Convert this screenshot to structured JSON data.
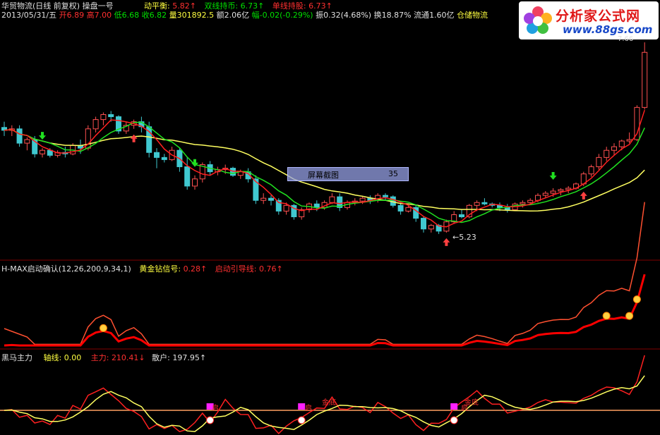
{
  "header": {
    "stock": "华贸物流(日线 前复权)",
    "indicator": "操盘一号",
    "dongpingheng_label": "动平衡:",
    "dongpingheng_value": "5.82↑",
    "shuangxian_label": "双线持币:",
    "shuangxian_value": "6.73↑",
    "danxian_label": "单线持股:",
    "danxian_value": "6.73↑"
  },
  "quote": {
    "date": "2013/05/31/五",
    "open_label": "开",
    "open": "6.89",
    "high_label": "高",
    "high": "7.00",
    "low_label": "低",
    "low": "6.68",
    "close_label": "收",
    "close": "6.82",
    "volume_label": "量",
    "volume": "301892.5",
    "amount_label": "额",
    "amount": "2.06亿",
    "change_label": "幅",
    "change": "-0.02(-0.29%)",
    "amplitude_label": "振",
    "amplitude": "0.32(4.68%)",
    "turnover_label": "换",
    "turnover": "18.87%",
    "float_label": "流通",
    "float": "1.60亿",
    "concept": "仓储物流"
  },
  "logo": {
    "title": "分析家公式网",
    "url": "www.88gs.com"
  },
  "annotations": {
    "low_price": "←5.23",
    "high_price": "7.66",
    "screenshot_tool": "屏幕截图",
    "screenshot_value": "35"
  },
  "panel2": {
    "title": "H-MAX启动确认(12,26,200,9,34,1)",
    "gold_label": "黄金钻信号:",
    "gold_value": "0.28↑",
    "start_label": "启动引导线:",
    "start_value": "0.76↑"
  },
  "panel3": {
    "title": "黑马主力",
    "axis_label": "轴线:",
    "axis_value": "0.00",
    "main_label": "主力:",
    "main_value": "210.41↓",
    "retail_label": "散户:",
    "retail_value": "197.95↑",
    "marker_jindi": "金底",
    "marker_qi": "启"
  },
  "chart_data": {
    "type": "candlestick",
    "colors": {
      "up": "#ff5050",
      "down": "#40c8d0",
      "ma_fast": "#ff2020",
      "ma_mid": "#20e020",
      "ma_slow": "#ffff60"
    },
    "ohlc": [
      [
        6.47,
        6.55,
        6.35,
        6.43
      ],
      [
        6.43,
        6.5,
        6.35,
        6.45
      ],
      [
        6.45,
        6.5,
        6.2,
        6.25
      ],
      [
        6.25,
        6.33,
        6.15,
        6.3
      ],
      [
        6.3,
        6.35,
        6.05,
        6.1
      ],
      [
        6.1,
        6.18,
        6.05,
        6.15
      ],
      [
        6.15,
        6.18,
        6.05,
        6.08
      ],
      [
        6.08,
        6.15,
        6.05,
        6.12
      ],
      [
        6.12,
        6.2,
        6.05,
        6.1
      ],
      [
        6.1,
        6.25,
        6.08,
        6.22
      ],
      [
        6.22,
        6.3,
        6.1,
        6.18
      ],
      [
        6.18,
        6.5,
        6.15,
        6.45
      ],
      [
        6.45,
        6.62,
        6.4,
        6.58
      ],
      [
        6.58,
        6.68,
        6.5,
        6.65
      ],
      [
        6.65,
        6.7,
        6.55,
        6.62
      ],
      [
        6.62,
        6.64,
        6.38,
        6.42
      ],
      [
        6.42,
        6.55,
        6.38,
        6.5
      ],
      [
        6.5,
        6.58,
        6.45,
        6.55
      ],
      [
        6.55,
        6.62,
        6.4,
        6.48
      ],
      [
        6.48,
        6.55,
        6.05,
        6.12
      ],
      [
        6.12,
        6.18,
        5.9,
        6.05
      ],
      [
        6.05,
        6.1,
        5.98,
        6.02
      ],
      [
        6.02,
        6.2,
        6.0,
        6.15
      ],
      [
        6.15,
        6.18,
        5.85,
        5.92
      ],
      [
        5.92,
        6.05,
        5.6,
        5.65
      ],
      [
        5.65,
        5.8,
        5.6,
        5.75
      ],
      [
        5.75,
        5.98,
        5.7,
        5.95
      ],
      [
        5.95,
        6.0,
        5.8,
        5.85
      ],
      [
        5.85,
        5.92,
        5.8,
        5.88
      ],
      [
        5.88,
        5.95,
        5.82,
        5.9
      ],
      [
        5.9,
        5.92,
        5.78,
        5.8
      ],
      [
        5.8,
        5.88,
        5.75,
        5.85
      ],
      [
        5.85,
        5.9,
        5.7,
        5.75
      ],
      [
        5.75,
        5.8,
        5.4,
        5.45
      ],
      [
        5.45,
        5.55,
        5.4,
        5.48
      ],
      [
        5.48,
        5.52,
        5.38,
        5.45
      ],
      [
        5.45,
        5.48,
        5.25,
        5.3
      ],
      [
        5.3,
        5.42,
        5.25,
        5.38
      ],
      [
        5.38,
        5.4,
        5.18,
        5.22
      ],
      [
        5.22,
        5.35,
        5.18,
        5.32
      ],
      [
        5.32,
        5.42,
        5.28,
        5.4
      ],
      [
        5.4,
        5.45,
        5.3,
        5.35
      ],
      [
        5.35,
        5.45,
        5.32,
        5.42
      ],
      [
        5.42,
        5.55,
        5.4,
        5.5
      ],
      [
        5.5,
        5.55,
        5.3,
        5.35
      ],
      [
        5.35,
        5.45,
        5.32,
        5.42
      ],
      [
        5.42,
        5.48,
        5.38,
        5.44
      ],
      [
        5.44,
        5.5,
        5.4,
        5.48
      ],
      [
        5.48,
        5.52,
        5.4,
        5.45
      ],
      [
        5.45,
        5.55,
        5.42,
        5.52
      ],
      [
        5.52,
        5.55,
        5.45,
        5.5
      ],
      [
        5.5,
        5.52,
        5.35,
        5.38
      ],
      [
        5.38,
        5.42,
        5.25,
        5.3
      ],
      [
        5.3,
        5.38,
        5.28,
        5.35
      ],
      [
        5.35,
        5.38,
        5.15,
        5.2
      ],
      [
        5.2,
        5.22,
        5.0,
        5.05
      ],
      [
        5.05,
        5.12,
        5.0,
        5.1
      ],
      [
        5.1,
        5.12,
        4.98,
        5.02
      ],
      [
        5.02,
        5.18,
        5.0,
        5.15
      ],
      [
        5.15,
        5.3,
        5.12,
        5.25
      ],
      [
        5.25,
        5.32,
        5.2,
        5.22
      ],
      [
        5.22,
        5.4,
        5.2,
        5.38
      ],
      [
        5.38,
        5.45,
        5.3,
        5.42
      ],
      [
        5.42,
        5.48,
        5.38,
        5.4
      ],
      [
        5.4,
        5.42,
        5.35,
        5.38
      ],
      [
        5.38,
        5.42,
        5.3,
        5.35
      ],
      [
        5.35,
        5.4,
        5.28,
        5.32
      ],
      [
        5.32,
        5.42,
        5.3,
        5.4
      ],
      [
        5.4,
        5.45,
        5.35,
        5.42
      ],
      [
        5.42,
        5.48,
        5.4,
        5.45
      ],
      [
        5.45,
        5.55,
        5.42,
        5.52
      ],
      [
        5.52,
        5.58,
        5.48,
        5.55
      ],
      [
        5.55,
        5.62,
        5.5,
        5.58
      ],
      [
        5.58,
        5.62,
        5.52,
        5.6
      ],
      [
        5.6,
        5.65,
        5.55,
        5.62
      ],
      [
        5.62,
        5.7,
        5.6,
        5.68
      ],
      [
        5.68,
        5.85,
        5.65,
        5.82
      ],
      [
        5.82,
        5.95,
        5.78,
        5.92
      ],
      [
        5.92,
        6.1,
        5.88,
        6.05
      ],
      [
        6.05,
        6.2,
        6.0,
        6.15
      ],
      [
        6.15,
        6.25,
        6.08,
        6.2
      ],
      [
        6.2,
        6.3,
        6.15,
        6.28
      ],
      [
        6.28,
        6.4,
        6.25,
        6.3
      ],
      [
        6.3,
        6.78,
        6.28,
        6.75
      ],
      [
        6.75,
        7.66,
        6.72,
        7.52
      ]
    ],
    "buy_markers_index": [
      17,
      58,
      76
    ],
    "sell_markers_index": [
      5,
      25,
      72
    ],
    "axis_range_panel1": [
      4.9,
      7.7
    ]
  }
}
